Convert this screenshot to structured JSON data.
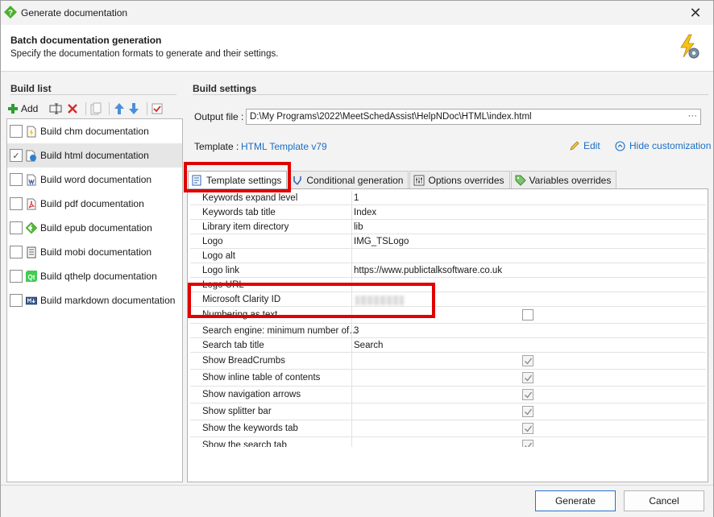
{
  "window": {
    "title": "Generate documentation",
    "close_glyph": "✕"
  },
  "header": {
    "title": "Batch documentation generation",
    "subtitle": "Specify the documentation formats to generate and their settings."
  },
  "build_list": {
    "heading": "Build list",
    "add_label": "Add",
    "items": [
      {
        "label": "Build chm documentation",
        "checked": false,
        "icon": "chm-icon"
      },
      {
        "label": "Build html documentation",
        "checked": true,
        "icon": "html-icon"
      },
      {
        "label": "Build word documentation",
        "checked": false,
        "icon": "word-icon"
      },
      {
        "label": "Build pdf documentation",
        "checked": false,
        "icon": "pdf-icon"
      },
      {
        "label": "Build epub documentation",
        "checked": false,
        "icon": "epub-icon"
      },
      {
        "label": "Build mobi documentation",
        "checked": false,
        "icon": "mobi-icon"
      },
      {
        "label": "Build qthelp documentation",
        "checked": false,
        "icon": "qthelp-icon"
      },
      {
        "label": "Build markdown documentation",
        "checked": false,
        "icon": "markdown-icon"
      }
    ]
  },
  "build_settings": {
    "heading": "Build settings",
    "output_label": "Output file :",
    "output_value": "D:\\My Programs\\2022\\MeetSchedAssist\\HelpNDoc\\HTML\\index.html",
    "output_browse": "···",
    "template_label": "Template :",
    "template_value": "HTML Template v79",
    "edit_label": "Edit",
    "hide_label": "Hide customization"
  },
  "tabs": [
    {
      "label": "Template settings",
      "active": true
    },
    {
      "label": "Conditional generation",
      "active": false
    },
    {
      "label": "Options overrides",
      "active": false
    },
    {
      "label": "Variables overrides",
      "active": false
    }
  ],
  "settings_rows": [
    {
      "name": "Keywords expand level",
      "value": "1",
      "type": "text"
    },
    {
      "name": "Keywords tab title",
      "value": "Index",
      "type": "text"
    },
    {
      "name": "Library item directory",
      "value": "lib",
      "type": "text"
    },
    {
      "name": "Logo",
      "value": "IMG_TSLogo",
      "type": "text"
    },
    {
      "name": "Logo alt",
      "value": "",
      "type": "text"
    },
    {
      "name": "Logo link",
      "value": "https://www.publictalksoftware.co.uk",
      "type": "text"
    },
    {
      "name": "Logo URL",
      "value": "",
      "type": "text"
    },
    {
      "name": "Microsoft Clarity ID",
      "value": "",
      "type": "blurred"
    },
    {
      "name": "Numbering as text",
      "value": "",
      "type": "checkbox",
      "checked": false
    },
    {
      "name": "Search engine: minimum number of…",
      "value": "3",
      "type": "text"
    },
    {
      "name": "Search tab title",
      "value": "Search",
      "type": "text"
    },
    {
      "name": "Show BreadCrumbs",
      "value": "",
      "type": "checkbox",
      "checked": true
    },
    {
      "name": "Show inline table of contents",
      "value": "",
      "type": "checkbox",
      "checked": true
    },
    {
      "name": "Show navigation arrows",
      "value": "",
      "type": "checkbox",
      "checked": true
    },
    {
      "name": "Show splitter bar",
      "value": "",
      "type": "checkbox",
      "checked": true
    },
    {
      "name": "Show the keywords tab",
      "value": "",
      "type": "checkbox",
      "checked": true
    },
    {
      "name": "Show the search tab",
      "value": "",
      "type": "checkbox",
      "checked": true
    }
  ],
  "footer": {
    "generate_label": "Generate",
    "cancel_label": "Cancel"
  },
  "colors": {
    "accent": "#1a6fc4",
    "highlight": "#e00000",
    "add_green": "#2e9e2e",
    "delete_red": "#d62b2b"
  }
}
